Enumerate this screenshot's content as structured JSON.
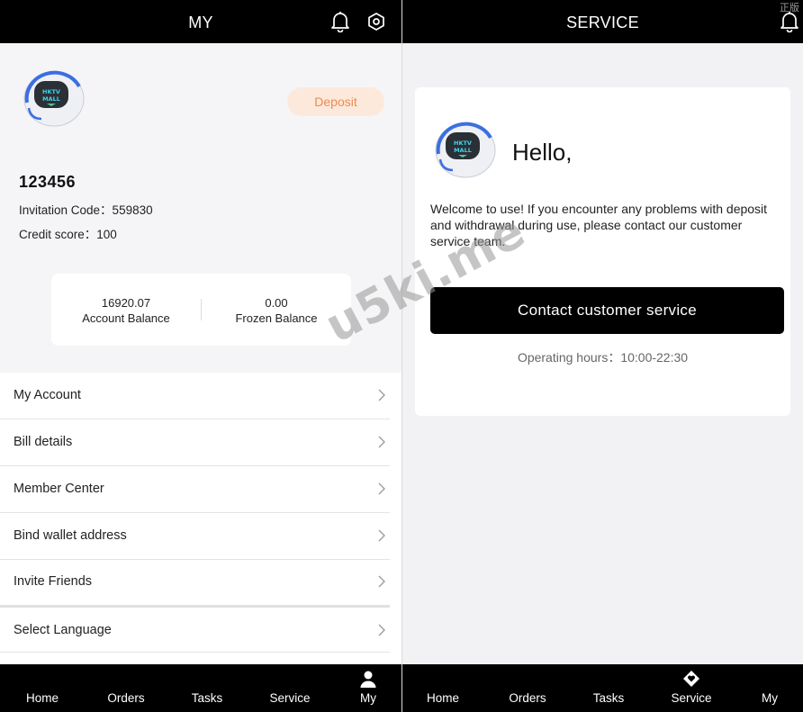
{
  "my": {
    "title": "MY",
    "deposit_label": "Deposit",
    "avatar_text": "HKTV MALL",
    "username": "123456",
    "invitation_line": "Invitation Code：559830",
    "credit_line": "Credit score：100",
    "account_balance_value": "16920.07",
    "account_balance_label": "Account Balance",
    "frozen_balance_value": "0.00",
    "frozen_balance_label": "Frozen Balance",
    "menu": [
      {
        "label": "My Account"
      },
      {
        "label": "Bill details"
      },
      {
        "label": "Member Center"
      },
      {
        "label": "Bind wallet address"
      },
      {
        "label": "Invite Friends"
      },
      {
        "label": "Select Language"
      }
    ],
    "tabs": [
      {
        "label": "Home",
        "active": false
      },
      {
        "label": "Orders",
        "active": false
      },
      {
        "label": "Tasks",
        "active": false
      },
      {
        "label": "Service",
        "active": false
      },
      {
        "label": "My",
        "active": true,
        "icon": "user-icon"
      }
    ],
    "icons": {
      "bell": "bell-icon",
      "settings": "settings-hex-icon"
    }
  },
  "service": {
    "title": "SERVICE",
    "corner_label": "正版",
    "avatar_text": "HKTV MALL",
    "hello": "Hello,",
    "welcome": "Welcome to use! If you encounter any problems with deposit and withdrawal during use, please contact our customer service team.",
    "contact_label": "Contact customer service",
    "hours": "Operating hours：10:00-22:30",
    "tabs": [
      {
        "label": "Home",
        "active": false
      },
      {
        "label": "Orders",
        "active": false
      },
      {
        "label": "Tasks",
        "active": false
      },
      {
        "label": "Service",
        "active": true,
        "icon": "heart-diamond-icon"
      },
      {
        "label": "My",
        "active": false
      }
    ]
  },
  "watermark": "u5ki.me",
  "colors": {
    "topbar": "#000000",
    "deposit_bg": "#fde9dc",
    "deposit_text": "#e98c50",
    "button": "#000000"
  }
}
